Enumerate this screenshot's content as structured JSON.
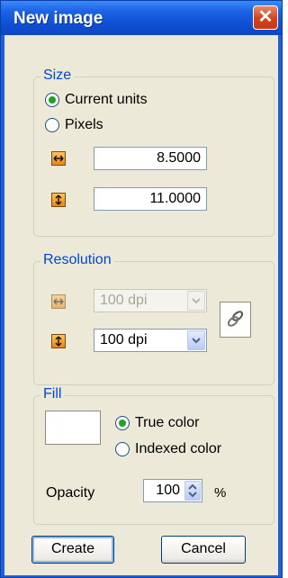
{
  "window": {
    "title": "New image",
    "close_glyph": "✕"
  },
  "size": {
    "legend": "Size",
    "current_units_label": "Current units",
    "pixels_label": "Pixels",
    "selected": "current_units",
    "width_value": "8.5000",
    "height_value": "11.0000"
  },
  "resolution": {
    "legend": "Resolution",
    "horizontal_value": "100 dpi",
    "vertical_value": "100 dpi",
    "horizontal_enabled": false,
    "link_icon": "chain-link-icon"
  },
  "fill": {
    "legend": "Fill",
    "swatch_color": "#ffffff",
    "true_color_label": "True color",
    "indexed_color_label": "Indexed color",
    "selected": "true_color",
    "opacity_label": "Opacity",
    "opacity_value": "100",
    "opacity_unit": "%"
  },
  "buttons": {
    "create_label": "Create",
    "cancel_label": "Cancel"
  },
  "colors": {
    "title_bar": "#0f4fd2",
    "face": "#ece9d8",
    "group_label": "#0046d5",
    "close_button": "#d2431c"
  }
}
